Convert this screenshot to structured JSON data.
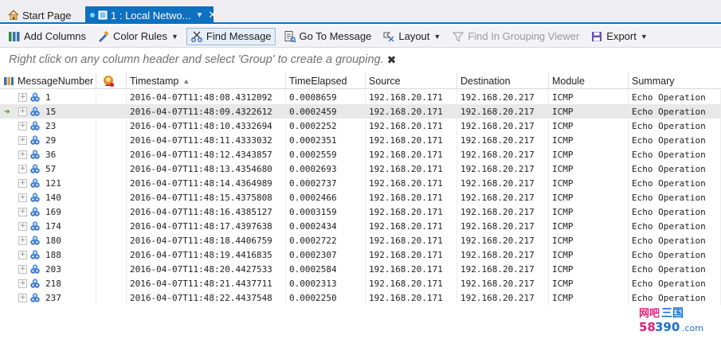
{
  "tabs": [
    {
      "label": "Start Page",
      "icon": "home-icon"
    },
    {
      "label": "1 : Local Netwo...",
      "icon": "network-capture-icon"
    }
  ],
  "toolbar": {
    "add_columns": "Add Columns",
    "color_rules": "Color Rules",
    "find_message": "Find Message",
    "go_to_message": "Go To Message",
    "layout": "Layout",
    "find_in_grouping_viewer": "Find In Grouping Viewer",
    "export": "Export"
  },
  "grouping_hint": "Right click on any column header and select 'Group' to create a grouping.",
  "columns": [
    "MessageNumber",
    "",
    "Timestamp",
    "TimeElapsed",
    "Source",
    "Destination",
    "Module",
    "Summary"
  ],
  "sorted_column": "Timestamp",
  "selected_row_index": 1,
  "rows": [
    {
      "num": "1",
      "ts": "2016-04-07T11:48:08.4312092",
      "el": "0.0008659",
      "src": "192.168.20.171",
      "dst": "192.168.20.217",
      "mod": "ICMP",
      "sum": "Echo Operation"
    },
    {
      "num": "15",
      "ts": "2016-04-07T11:48:09.4322612",
      "el": "0.0002459",
      "src": "192.168.20.171",
      "dst": "192.168.20.217",
      "mod": "ICMP",
      "sum": "Echo Operation"
    },
    {
      "num": "23",
      "ts": "2016-04-07T11:48:10.4332694",
      "el": "0.0002252",
      "src": "192.168.20.171",
      "dst": "192.168.20.217",
      "mod": "ICMP",
      "sum": "Echo Operation"
    },
    {
      "num": "29",
      "ts": "2016-04-07T11:48:11.4333032",
      "el": "0.0002351",
      "src": "192.168.20.171",
      "dst": "192.168.20.217",
      "mod": "ICMP",
      "sum": "Echo Operation"
    },
    {
      "num": "36",
      "ts": "2016-04-07T11:48:12.4343857",
      "el": "0.0002559",
      "src": "192.168.20.171",
      "dst": "192.168.20.217",
      "mod": "ICMP",
      "sum": "Echo Operation"
    },
    {
      "num": "57",
      "ts": "2016-04-07T11:48:13.4354680",
      "el": "0.0002693",
      "src": "192.168.20.171",
      "dst": "192.168.20.217",
      "mod": "ICMP",
      "sum": "Echo Operation"
    },
    {
      "num": "121",
      "ts": "2016-04-07T11:48:14.4364989",
      "el": "0.0002737",
      "src": "192.168.20.171",
      "dst": "192.168.20.217",
      "mod": "ICMP",
      "sum": "Echo Operation"
    },
    {
      "num": "140",
      "ts": "2016-04-07T11:48:15.4375808",
      "el": "0.0002466",
      "src": "192.168.20.171",
      "dst": "192.168.20.217",
      "mod": "ICMP",
      "sum": "Echo Operation"
    },
    {
      "num": "169",
      "ts": "2016-04-07T11:48:16.4385127",
      "el": "0.0003159",
      "src": "192.168.20.171",
      "dst": "192.168.20.217",
      "mod": "ICMP",
      "sum": "Echo Operation"
    },
    {
      "num": "174",
      "ts": "2016-04-07T11:48:17.4397638",
      "el": "0.0002434",
      "src": "192.168.20.171",
      "dst": "192.168.20.217",
      "mod": "ICMP",
      "sum": "Echo Operation"
    },
    {
      "num": "180",
      "ts": "2016-04-07T11:48:18.4406759",
      "el": "0.0002722",
      "src": "192.168.20.171",
      "dst": "192.168.20.217",
      "mod": "ICMP",
      "sum": "Echo Operation"
    },
    {
      "num": "188",
      "ts": "2016-04-07T11:48:19.4416835",
      "el": "0.0002307",
      "src": "192.168.20.171",
      "dst": "192.168.20.217",
      "mod": "ICMP",
      "sum": "Echo Operation"
    },
    {
      "num": "203",
      "ts": "2016-04-07T11:48:20.4427533",
      "el": "0.0002584",
      "src": "192.168.20.171",
      "dst": "192.168.20.217",
      "mod": "ICMP",
      "sum": "Echo Operation"
    },
    {
      "num": "218",
      "ts": "2016-04-07T11:48:21.4437711",
      "el": "0.0002313",
      "src": "192.168.20.171",
      "dst": "192.168.20.217",
      "mod": "ICMP",
      "sum": "Echo Operation"
    },
    {
      "num": "237",
      "ts": "2016-04-07T11:48:22.4437548",
      "el": "0.0002250",
      "src": "192.168.20.171",
      "dst": "192.168.20.217",
      "mod": "ICMP",
      "sum": "Echo Operation"
    }
  ],
  "watermark": {
    "top": "网吧三国",
    "bottom": "58390.com"
  },
  "colors": {
    "accent": "#0e70c0",
    "selected_row": "#e8e8e8"
  }
}
